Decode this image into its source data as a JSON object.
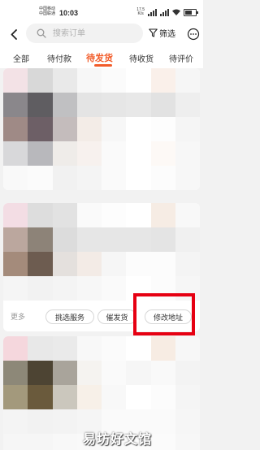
{
  "status_bar": {
    "carrier1": "中国移动",
    "carrier2": "中国联通",
    "time": "10:03",
    "speed_value": "17.5",
    "speed_unit": "K/s",
    "battery_level_percent": 70
  },
  "header": {
    "search_placeholder": "搜索订单",
    "filter_label": "筛选"
  },
  "tabs": [
    {
      "label": "全部",
      "active": false
    },
    {
      "label": "待付款",
      "active": false
    },
    {
      "label": "待发货",
      "active": true
    },
    {
      "label": "待收货",
      "active": false
    },
    {
      "label": "待评价",
      "active": false
    }
  ],
  "order_card_2": {
    "more_label": "更多",
    "buttons": [
      {
        "label": "挑选服务"
      },
      {
        "label": "催发货"
      },
      {
        "label": "修改地址"
      }
    ]
  },
  "colors": {
    "accent": "#f25c2a",
    "highlight_box": "#e60012"
  },
  "mosaics": {
    "card1": [
      "#f3e2e6",
      "#d8d8d8",
      "#e9e9e9",
      "#f7f7f7",
      "#fbfbfb",
      "#ffffff",
      "#faf0ea",
      "#f6f6f6",
      "#8a878b",
      "#5f5d61",
      "#c0c0c2",
      "#e4e4e4",
      "#e6e6e6",
      "#e8e8e8",
      "#e2e2e2",
      "#eeeeee",
      "#9f8a86",
      "#6d5f66",
      "#c4bcbc",
      "#f3ece7",
      "#f7f7f7",
      "#ffffff",
      "#fdfdfd",
      "#f5f5f5",
      "#d8d8da",
      "#b8b8bc",
      "#efece9",
      "#f7f1ee",
      "#fafafa",
      "#ffffff",
      "#fdf9f6",
      "#f7f7f7",
      "#f9f9f9",
      "#fbfbfb",
      "#f1f1f1",
      "#f4f4f4",
      "#fafafa",
      "#ffffff",
      "#fcfcfc",
      "#f7f7f7"
    ],
    "card2": [
      "#f3dde4",
      "#dddddd",
      "#e2e2e2",
      "#fafafa",
      "#fdfdfd",
      "#ffffff",
      "#f6ece4",
      "#f8f8f8",
      "#bba79e",
      "#8d8378",
      "#dcdcdc",
      "#e6e6e6",
      "#e6e6e6",
      "#e6e6e6",
      "#e4e4e4",
      "#f0f0f0",
      "#a48b7b",
      "#6d5c50",
      "#e4e0dd",
      "#f3ebe6",
      "#f6f6f6",
      "#fcfcfc",
      "#fcfcfc",
      "#f4f4f4",
      "#f5f5f5",
      "#f2f2f2",
      "#f4f4f4",
      "#f7f7f7",
      "#fafafa",
      "#ffffff",
      "#fcfcfc",
      "#f6f6f6"
    ],
    "card3": [
      "#f5d7dd",
      "#e8e8e8",
      "#eaeaea",
      "#f8f8f8",
      "#fbfbfb",
      "#ffffff",
      "#f7ece3",
      "#f7f7f7",
      "#8d8878",
      "#4d4433",
      "#a9a49b",
      "#f5f3f0",
      "#fafafa",
      "#f6f6f6",
      "#f9f9f9",
      "#f3f3f3",
      "#a3997c",
      "#6a5a3c",
      "#cbc7bd",
      "#f7f0e8",
      "#f8f8f8",
      "#ffffff",
      "#fcfcfc",
      "#f5f5f5",
      "#f4f4f4",
      "#f2f2f2",
      "#f3f3f3",
      "#f5f5f5",
      "#fafafa",
      "#fafafa",
      "#fafafa",
      "#f6f6f6",
      "#f6f6f6",
      "#f6f6f6",
      "#f8f8f8",
      "#f9f9f9",
      "#fbfbfb",
      "#fcfcfc",
      "#fbfbfb",
      "#f7f7f7"
    ]
  },
  "watermark": "易坊好文馆"
}
